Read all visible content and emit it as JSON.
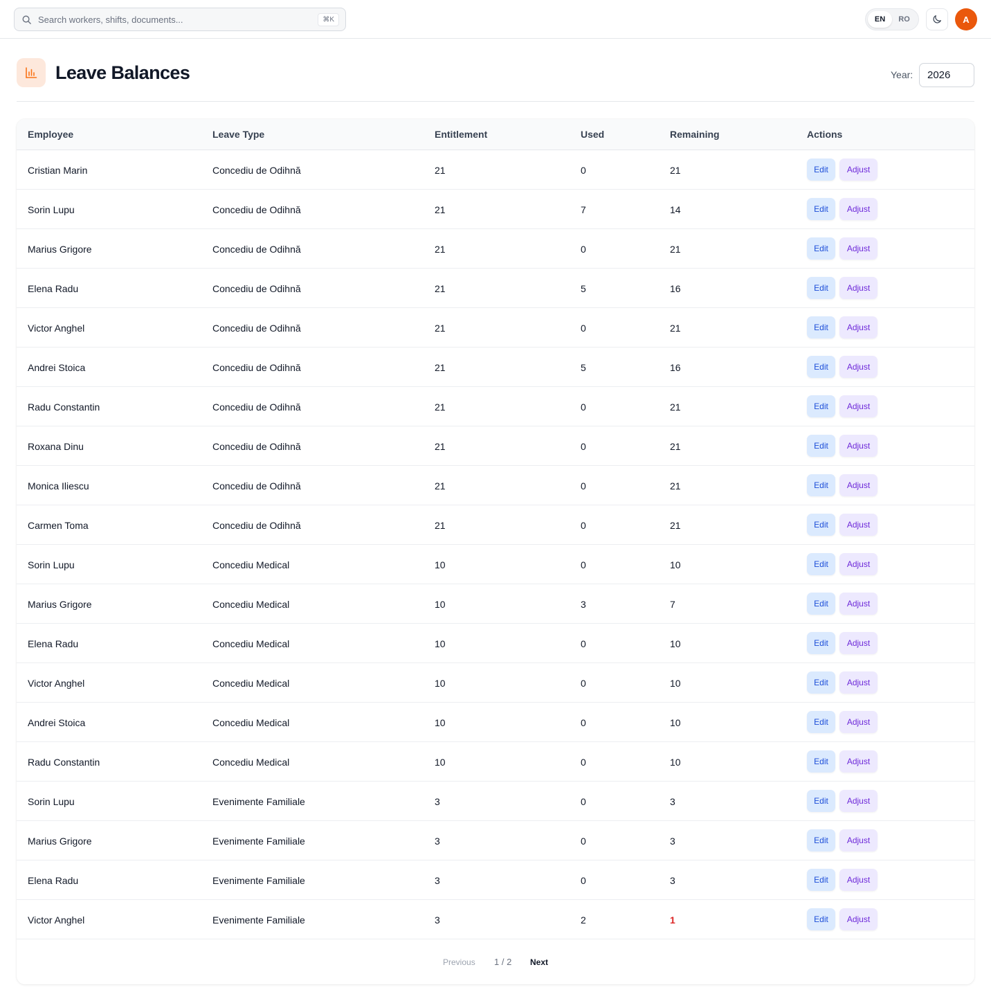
{
  "topbar": {
    "search_placeholder": "Search workers, shifts, documents...",
    "search_shortcut": "⌘K",
    "languages": [
      "EN",
      "RO"
    ],
    "active_language": "EN",
    "theme_icon": "moon-icon",
    "avatar_initial": "A",
    "avatar_color": "#ea580c"
  },
  "page": {
    "icon": "bar-chart-icon",
    "title": "Leave Balances",
    "year_label": "Year:",
    "year_value": "2026"
  },
  "table": {
    "columns": [
      "Employee",
      "Leave Type",
      "Entitlement",
      "Used",
      "Remaining",
      "Actions"
    ],
    "edit_label": "Edit",
    "adjust_label": "Adjust",
    "rows": [
      {
        "employee": "Cristian Marin",
        "leave_type": "Concediu de Odihnă",
        "entitlement": "21",
        "used": "0",
        "remaining": "21"
      },
      {
        "employee": "Sorin Lupu",
        "leave_type": "Concediu de Odihnă",
        "entitlement": "21",
        "used": "7",
        "remaining": "14"
      },
      {
        "employee": "Marius Grigore",
        "leave_type": "Concediu de Odihnă",
        "entitlement": "21",
        "used": "0",
        "remaining": "21"
      },
      {
        "employee": "Elena Radu",
        "leave_type": "Concediu de Odihnă",
        "entitlement": "21",
        "used": "5",
        "remaining": "16"
      },
      {
        "employee": "Victor Anghel",
        "leave_type": "Concediu de Odihnă",
        "entitlement": "21",
        "used": "0",
        "remaining": "21"
      },
      {
        "employee": "Andrei Stoica",
        "leave_type": "Concediu de Odihnă",
        "entitlement": "21",
        "used": "5",
        "remaining": "16"
      },
      {
        "employee": "Radu Constantin",
        "leave_type": "Concediu de Odihnă",
        "entitlement": "21",
        "used": "0",
        "remaining": "21"
      },
      {
        "employee": "Roxana Dinu",
        "leave_type": "Concediu de Odihnă",
        "entitlement": "21",
        "used": "0",
        "remaining": "21"
      },
      {
        "employee": "Monica Iliescu",
        "leave_type": "Concediu de Odihnă",
        "entitlement": "21",
        "used": "0",
        "remaining": "21"
      },
      {
        "employee": "Carmen Toma",
        "leave_type": "Concediu de Odihnă",
        "entitlement": "21",
        "used": "0",
        "remaining": "21"
      },
      {
        "employee": "Sorin Lupu",
        "leave_type": "Concediu Medical",
        "entitlement": "10",
        "used": "0",
        "remaining": "10"
      },
      {
        "employee": "Marius Grigore",
        "leave_type": "Concediu Medical",
        "entitlement": "10",
        "used": "3",
        "remaining": "7"
      },
      {
        "employee": "Elena Radu",
        "leave_type": "Concediu Medical",
        "entitlement": "10",
        "used": "0",
        "remaining": "10"
      },
      {
        "employee": "Victor Anghel",
        "leave_type": "Concediu Medical",
        "entitlement": "10",
        "used": "0",
        "remaining": "10"
      },
      {
        "employee": "Andrei Stoica",
        "leave_type": "Concediu Medical",
        "entitlement": "10",
        "used": "0",
        "remaining": "10"
      },
      {
        "employee": "Radu Constantin",
        "leave_type": "Concediu Medical",
        "entitlement": "10",
        "used": "0",
        "remaining": "10"
      },
      {
        "employee": "Sorin Lupu",
        "leave_type": "Evenimente Familiale",
        "entitlement": "3",
        "used": "0",
        "remaining": "3"
      },
      {
        "employee": "Marius Grigore",
        "leave_type": "Evenimente Familiale",
        "entitlement": "3",
        "used": "0",
        "remaining": "3"
      },
      {
        "employee": "Elena Radu",
        "leave_type": "Evenimente Familiale",
        "entitlement": "3",
        "used": "0",
        "remaining": "3"
      },
      {
        "employee": "Victor Anghel",
        "leave_type": "Evenimente Familiale",
        "entitlement": "3",
        "used": "2",
        "remaining": "1",
        "low": true
      }
    ]
  },
  "pagination": {
    "previous_label": "Previous",
    "page_indicator": "1 / 2",
    "next_label": "Next"
  },
  "colors": {
    "accent": "#ea580c",
    "edit_bg": "#dbeafe",
    "edit_text": "#1d4ed8",
    "adjust_bg": "#ede9fe",
    "adjust_text": "#6d28d9",
    "low_balance": "#dc2626"
  }
}
